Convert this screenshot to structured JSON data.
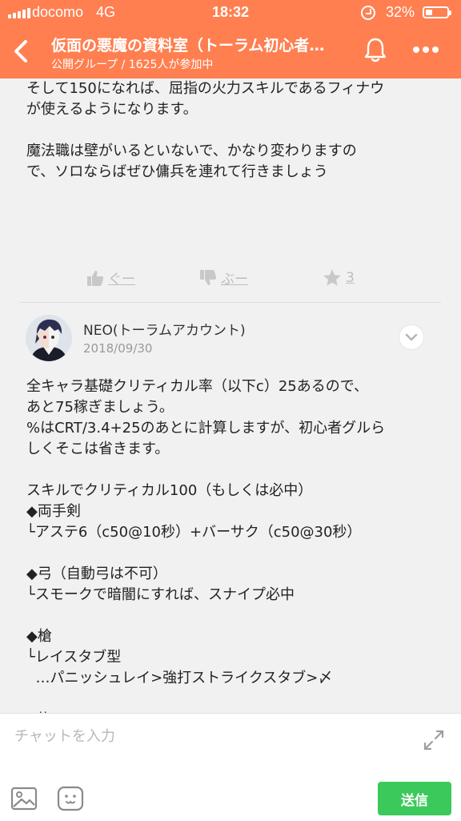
{
  "status_bar": {
    "carrier": "docomo",
    "network": "4G",
    "time": "18:32",
    "battery": "32%"
  },
  "header": {
    "back_icon": "chevron-left-icon",
    "title": "仮面の悪魔の資料室（トーラム初心者…",
    "subtitle": "公開グループ / 1625人が参加中",
    "bell_icon": "bell-icon",
    "more_icon": "more-dots-icon",
    "background_color": "#ff7f50"
  },
  "previous_message": {
    "text": "そして150になれば、屈指の火力スキルであるフィナウ\nが使えるようになります。\n\n魔法職は壁がいるといないで、かなり変わりますの\nで、ソロならばぜひ傭兵を連れて行きましょう"
  },
  "reactions": {
    "good_label": "ぐー",
    "bad_label": "ぶー",
    "star_count": "3"
  },
  "post": {
    "author": "NEO(トーラムアカウント)",
    "date": "2018/09/30",
    "text": "全キャラ基礎クリティカル率（以下c）25あるので、\nあと75稼ぎましょう。\n%はCRT/3.4+25のあとに計算しますが、初心者グルら\nしくそこは省きます。\n\nスキルでクリティカル100（もしくは必中）\n◆両手剣\n└アステ6（c50@10秒）+バーサク（c50@30秒）\n\n◆弓（自動弓は不可）\n└スモークで暗闇にすれば、スナイプ必中\n\n◆槍\n└レイスタブ型\n  …パニッシュレイ>強打ストライクスタブ>〆\n\n◆抜刀"
  },
  "input_bar": {
    "placeholder": "チャットを入力",
    "send_label": "送信",
    "send_color": "#3cc95b"
  }
}
